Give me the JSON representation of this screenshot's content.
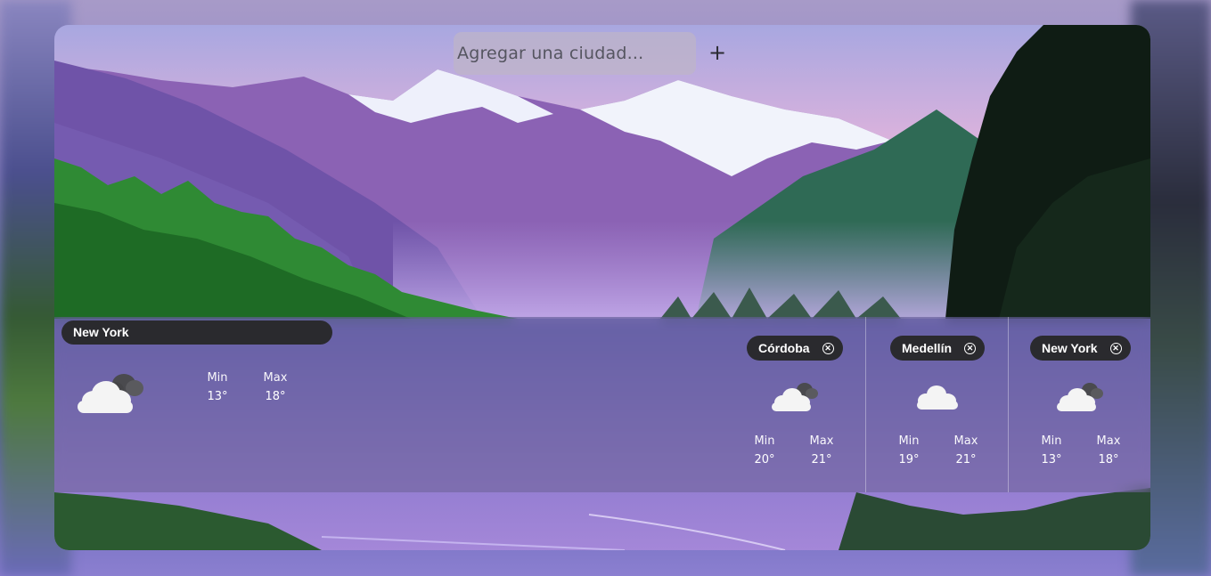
{
  "search": {
    "placeholder": "Agregar una ciudad...",
    "add_label": "+"
  },
  "current": {
    "city": "New York",
    "icon": "cloudy-icon",
    "min_label": "Min",
    "max_label": "Max",
    "min": "13°",
    "max": "18°"
  },
  "cities": [
    {
      "name": "Córdoba",
      "icon": "cloudy-icon",
      "min_label": "Min",
      "max_label": "Max",
      "min": "20°",
      "max": "21°"
    },
    {
      "name": "Medellín",
      "icon": "cloud-icon",
      "min_label": "Min",
      "max_label": "Max",
      "min": "19°",
      "max": "21°"
    },
    {
      "name": "New York",
      "icon": "cloudy-icon",
      "min_label": "Min",
      "max_label": "Max",
      "min": "13°",
      "max": "18°"
    }
  ],
  "colors": {
    "chip": "#2a2a2e",
    "panel": "rgba(95,88,128,0.42)",
    "text": "#ffffff"
  }
}
